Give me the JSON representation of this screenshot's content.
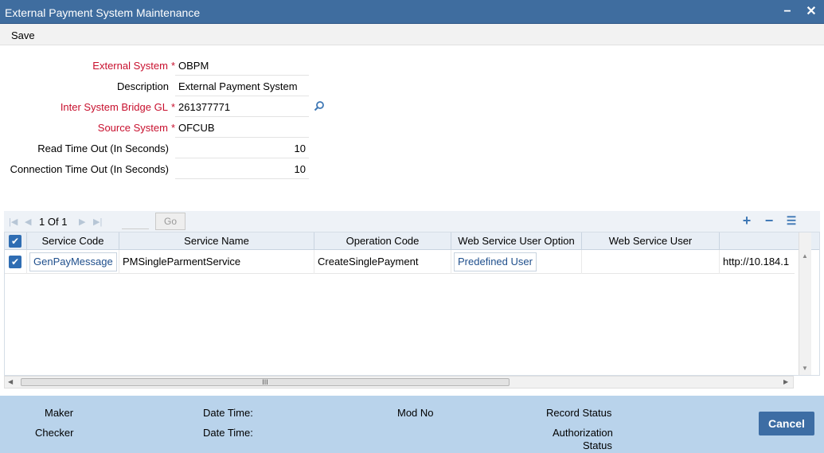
{
  "window": {
    "title": "External Payment System Maintenance",
    "minimize_label": "−",
    "close_label": "✕"
  },
  "toolbar": {
    "save_label": "Save"
  },
  "form": {
    "external_system": {
      "label": "External System",
      "value": "OBPM",
      "required": true
    },
    "description": {
      "label": "Description",
      "value": "External Payment System"
    },
    "bridge_gl": {
      "label": "Inter System Bridge GL",
      "value": "261377771",
      "required": true
    },
    "source_system": {
      "label": "Source System",
      "value": "OFCUB",
      "required": true
    },
    "read_timeout": {
      "label": "Read Time Out (In Seconds)",
      "value": "10"
    },
    "connection_timeout": {
      "label": "Connection Time Out (In Seconds)",
      "value": "10"
    },
    "required_marker": "*",
    "lov_icon": "search-icon"
  },
  "pager": {
    "current": "1",
    "of_label": "Of",
    "total": "1",
    "go_label": "Go",
    "add_label": "+",
    "remove_label": "−",
    "list_label": "☰"
  },
  "grid": {
    "columns": [
      "Service Code",
      "Service Name",
      "Operation Code",
      "Web Service User Option",
      "Web Service User"
    ],
    "rows": [
      {
        "service_code": "GenPayMessage",
        "service_name": "PMSingleParmentService",
        "operation_code": "CreateSinglePayment",
        "ws_user_option": "Predefined User",
        "ws_user": "",
        "url": "http://10.184.1"
      }
    ],
    "scroll_grip": "III"
  },
  "footer": {
    "maker": "Maker",
    "checker": "Checker",
    "date_time_1": "Date Time:",
    "date_time_2": "Date Time:",
    "mod_no": "Mod No",
    "record_status": "Record Status",
    "authorization_status_line1": "Authorization",
    "authorization_status_line2": "Status",
    "cancel_label": "Cancel"
  },
  "colors": {
    "titlebar": "#3f6d9f",
    "required_label": "#c8102e",
    "footer": "#b9d3eb",
    "cancel_button": "#3d6da4"
  }
}
